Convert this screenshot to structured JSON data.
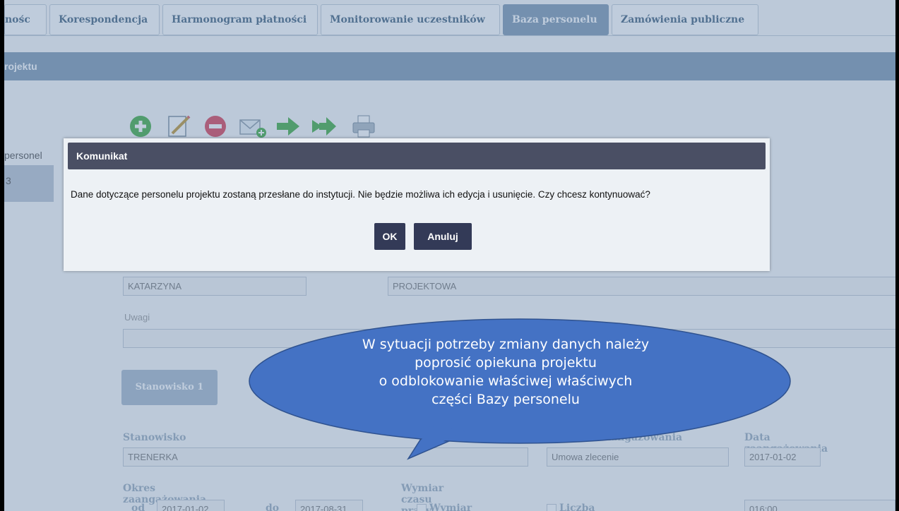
{
  "tabs": [
    "nośc",
    "Korespondencja",
    "Harmonogram płatności",
    "Monitorowanie uczestników",
    "Baza personelu",
    "Zamówienia publiczne"
  ],
  "active_tab": "Baza personelu",
  "section_bar": {
    "title": "rojektu"
  },
  "toolbar": {
    "icons": [
      "add-icon",
      "edit-icon",
      "remove-icon",
      "send-mail-icon",
      "forward-icon",
      "forward-all-icon",
      "print-icon"
    ]
  },
  "left_nav": {
    "label": "personel",
    "number": "3"
  },
  "form": {
    "first_name_value": "KATARZYNA",
    "last_name_value": "PROJEKTOWA",
    "notes_label": "Uwagi",
    "notes_value": "",
    "position_button": "Stanowisko 1",
    "position_label": "Stanowisko",
    "position_value": "TRENERKA",
    "engagement_form_label": "zaangażowania",
    "engagement_form_value": "Umowa zlecenie",
    "engagement_date_label": "Data zaangażowania",
    "engagement_date_value": "2017-01-02",
    "period_label": "Okres zaangażowania",
    "period_from_label": "od",
    "period_from_value": "2017-01-02",
    "period_to_label": "do",
    "period_to_value": "2017-08-31",
    "work_time_label": "Wymiar czasu pracy",
    "work_time_option1": "Wymiar",
    "work_time_option2": "Liczba godzin w",
    "hours_value": "016:00"
  },
  "modal": {
    "title": "Komunikat",
    "message": "Dane dotyczące personelu projektu zostaną przesłane do instytucji. Nie będzie możliwa ich edycja i usunięcie. Czy chcesz kontynuować?",
    "ok_label": "OK",
    "cancel_label": "Anuluj"
  },
  "callout": {
    "lines": [
      "W sytuacji potrzeby zmiany danych należy",
      "poprosić opiekuna projektu",
      "o odblokowanie właściwej właściwych",
      "części Bazy personelu"
    ],
    "fill_color": "#4472c4",
    "border_color": "#2f528f"
  },
  "colors": {
    "tab_active_bg": "#8fa6bd",
    "modal_header_bg": "#4a4f64",
    "button_bg": "#333a57"
  }
}
